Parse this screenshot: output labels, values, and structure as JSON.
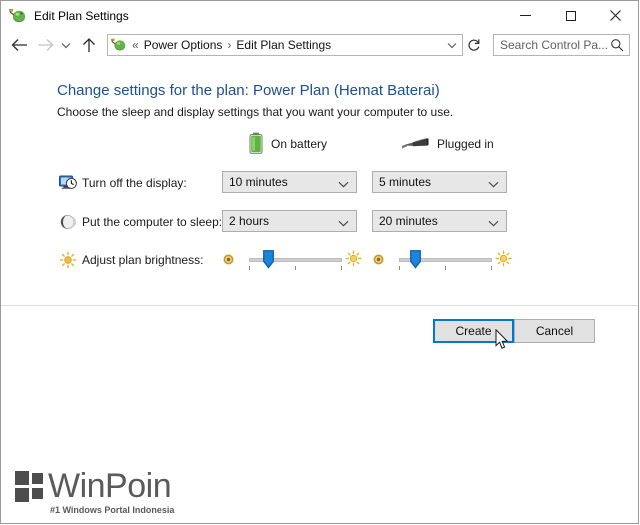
{
  "window": {
    "title": "Edit Plan Settings",
    "title_icon": "power-plan-icon",
    "minimize_label": "Minimize",
    "maximize_label": "Maximize",
    "close_label": "Close"
  },
  "navbar": {
    "back_icon": "back-arrow-icon",
    "forward_icon": "forward-arrow-icon",
    "history_icon": "chevron-down-icon",
    "up_icon": "up-arrow-icon",
    "address_icon": "power-plan-icon",
    "breadcrumb_prefix": "«",
    "breadcrumb": [
      {
        "label": "Power Options"
      },
      {
        "label": "Edit Plan Settings"
      }
    ],
    "breadcrumb_separator": "›",
    "dropdown_icon": "chevron-down-icon",
    "refresh_icon": "refresh-icon",
    "search": {
      "placeholder": "Search Control Pa...",
      "value": "",
      "icon": "search-icon"
    }
  },
  "content": {
    "heading": "Change settings for the plan: Power Plan (Hemat Baterai)",
    "subheading": "Choose the sleep and display settings that you want your computer to use.",
    "columns": [
      {
        "id": "on-battery",
        "label": "On battery",
        "icon": "battery-icon"
      },
      {
        "id": "plugged-in",
        "label": "Plugged in",
        "icon": "power-plug-icon"
      }
    ],
    "rows": [
      {
        "id": "turn-off-display",
        "icon": "display-clock-icon",
        "label": "Turn off the display:",
        "type": "dropdown",
        "on_battery": "10 minutes",
        "plugged_in": "5 minutes"
      },
      {
        "id": "computer-sleep",
        "icon": "moon-icon",
        "label": "Put the computer to sleep:",
        "type": "dropdown",
        "on_battery": "2 hours",
        "plugged_in": "20 minutes"
      },
      {
        "id": "plan-brightness",
        "icon": "brightness-icon",
        "label": "Adjust plan brightness:",
        "type": "slider",
        "on_battery": 22,
        "plugged_in": 20,
        "min_icon": "dim-sun-icon",
        "max_icon": "bright-sun-icon"
      }
    ]
  },
  "footer": {
    "create_label": "Create",
    "cancel_label": "Cancel"
  },
  "watermark": {
    "name": "WinPoin",
    "tagline": "#1 Windows Portal Indonesia"
  },
  "colors": {
    "heading_blue": "#1d4f91",
    "focus_blue": "#0078d7",
    "slider_thumb": "#0a6fc2",
    "battery_green": "#6cbb3c",
    "button_face": "#e1e1e1"
  }
}
